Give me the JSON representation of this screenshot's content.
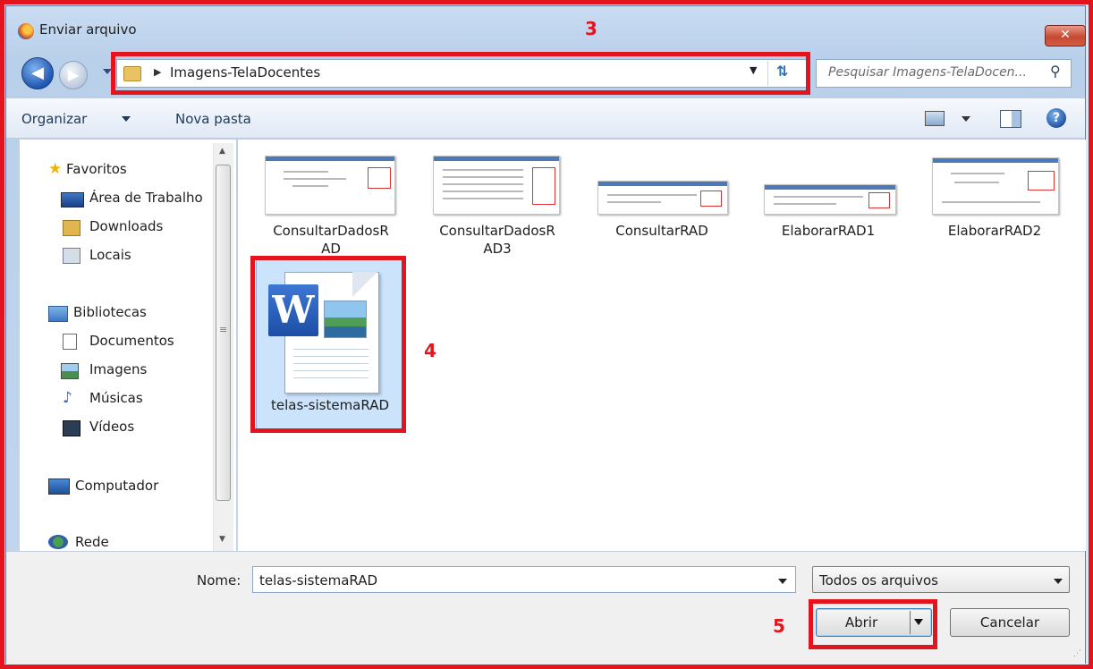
{
  "window": {
    "title": "Enviar arquivo",
    "close_label": "✕"
  },
  "nav": {
    "back_glyph": "◀",
    "forward_glyph": "▶",
    "breadcrumb_arrow": "▶",
    "path": "Imagens-TelaDocentes",
    "search_placeholder": "Pesquisar Imagens-TelaDocen...",
    "search_icon": "magnifier-icon",
    "refresh_glyph": "⇅"
  },
  "toolbar": {
    "organize": "Organizar",
    "new_folder": "Nova pasta",
    "help_glyph": "?"
  },
  "sidebar": {
    "favorites": "Favoritos",
    "desktop": "Área de Trabalho",
    "downloads": "Downloads",
    "places": "Locais",
    "libraries": "Bibliotecas",
    "documents": "Documentos",
    "images": "Imagens",
    "music": "Músicas",
    "videos": "Vídeos",
    "computer": "Computador",
    "network": "Rede"
  },
  "files": [
    {
      "name": "ConsultarDadosR",
      "name2": "AD"
    },
    {
      "name": "ConsultarDadosR",
      "name2": "AD3"
    },
    {
      "name": "ConsultarRAD",
      "name2": ""
    },
    {
      "name": "ElaborarRAD1",
      "name2": ""
    },
    {
      "name": "ElaborarRAD2",
      "name2": ""
    }
  ],
  "selected_file": {
    "name": "telas-sistemaRAD",
    "icon": "word-document-icon"
  },
  "footer": {
    "name_label": "Nome:",
    "name_value": "telas-sistemaRAD",
    "type_value": "Todos os arquivos",
    "open": "Abrir",
    "cancel": "Cancelar"
  },
  "annotations": {
    "a3": "3",
    "a4": "4",
    "a5": "5"
  },
  "colors": {
    "annotation": "#e4141e",
    "selection": "#cce4fb"
  }
}
